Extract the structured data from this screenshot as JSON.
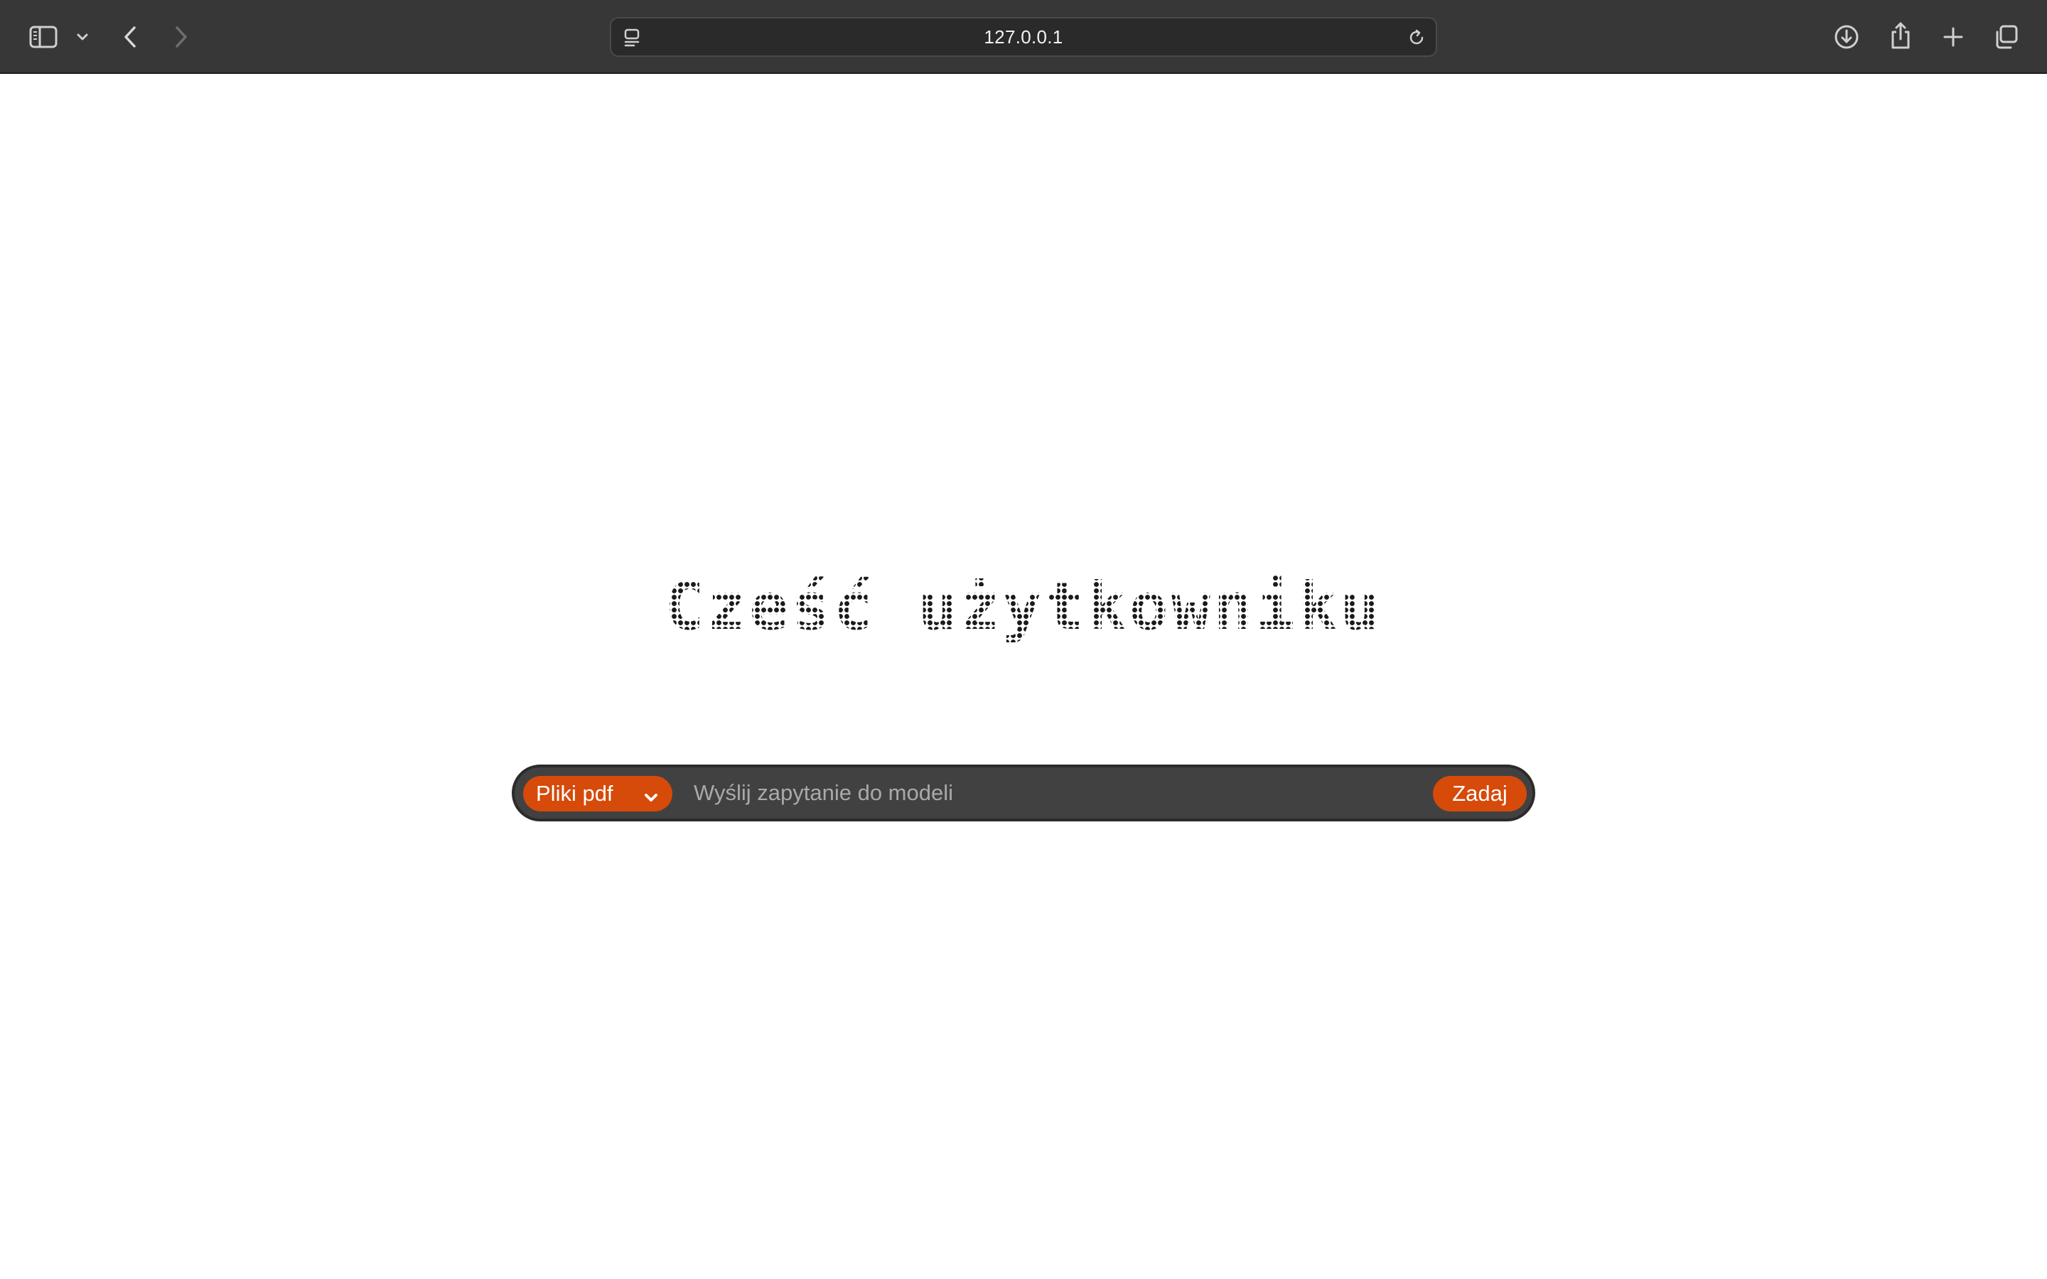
{
  "browser": {
    "url": "127.0.0.1",
    "icons": {
      "sidebar": "sidebar-icon",
      "sidebar_menu": "chevron-down-icon",
      "back": "chevron-left-icon",
      "forward": "chevron-right-icon",
      "site_settings": "page-settings-icon",
      "reload": "reload-icon",
      "downloads": "download-icon",
      "share": "share-icon",
      "new_tab": "plus-icon",
      "tab_overview": "tabs-overview-icon"
    },
    "colors": {
      "toolbar": "#373737",
      "urlbar": "#2a2a2a"
    }
  },
  "main": {
    "greeting": "Cześć użytkowniku",
    "query": {
      "source_selected": "Pliki pdf",
      "placeholder": "Wyślij zapytanie do modeli",
      "value": "",
      "submit_label": "Zadaj"
    },
    "colors": {
      "accent": "#d64a0a",
      "bar": "#414141"
    }
  }
}
